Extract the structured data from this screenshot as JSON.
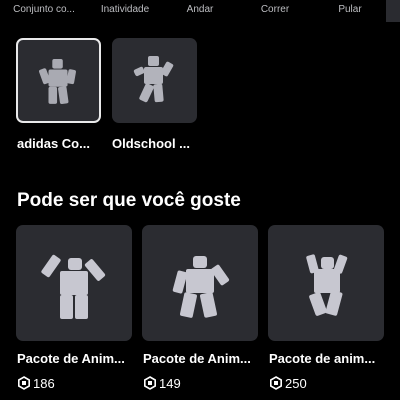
{
  "tabs": [
    {
      "label": "Conjunto co..."
    },
    {
      "label": "Inatividade"
    },
    {
      "label": "Andar"
    },
    {
      "label": "Correr"
    },
    {
      "label": "Pular"
    }
  ],
  "owned": [
    {
      "label": "adidas Co...",
      "thumbnail_icon": "avatar-pose-icon",
      "selected": true
    },
    {
      "label": "Oldschool ...",
      "thumbnail_icon": "avatar-pose-icon",
      "selected": false
    }
  ],
  "recommendations": {
    "title": "Pode ser que você goste",
    "items": [
      {
        "label": "Pacote de Anim...",
        "price": "186",
        "currency_icon": "robux-icon"
      },
      {
        "label": "Pacote de Anim...",
        "price": "149",
        "currency_icon": "robux-icon"
      },
      {
        "label": "Pacote de anim...",
        "price": "250",
        "currency_icon": "robux-icon"
      }
    ]
  },
  "colors": {
    "background": "#000000",
    "card": "#2b2c31",
    "tab_text": "#bdbec2",
    "selected_border": "#e9e9ea",
    "figure": "#c7c7d0"
  }
}
